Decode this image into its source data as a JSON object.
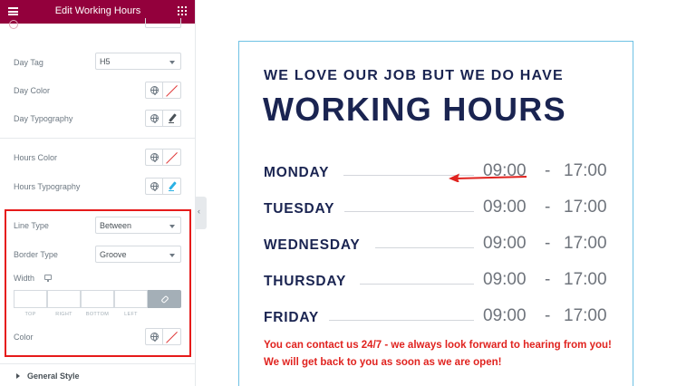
{
  "panel": {
    "title": "Edit Working Hours",
    "controls": {
      "day_tag": {
        "label": "Day Tag",
        "value": "H5"
      },
      "day_color": {
        "label": "Day Color"
      },
      "day_typography": {
        "label": "Day Typography"
      },
      "hours_color": {
        "label": "Hours Color"
      },
      "hours_typography": {
        "label": "Hours Typography"
      },
      "line_type": {
        "label": "Line Type",
        "value": "Between"
      },
      "border_type": {
        "label": "Border Type",
        "value": "Groove"
      },
      "width": {
        "label": "Width",
        "sides": [
          "TOP",
          "RIGHT",
          "BOTTOM",
          "LEFT"
        ]
      },
      "color": {
        "label": "Color"
      }
    },
    "section_general": "General Style",
    "icons": [
      "menu-icon",
      "grid-icon",
      "globe-icon",
      "reset-color-icon",
      "pencil-icon",
      "link-icon",
      "desktop-icon",
      "chevron-left-icon",
      "caret-right-icon"
    ],
    "colors": {
      "header": "#93003c",
      "highlight_box": "#e61a1a",
      "link_button": "#a4afb7"
    }
  },
  "preview": {
    "kicker": "WE LOVE OUR JOB BUT WE DO HAVE",
    "headline": "WORKING HOURS",
    "rows": [
      {
        "day": "MONDAY",
        "open": "09:00",
        "sep": "-",
        "close": "17:00"
      },
      {
        "day": "TUESDAY",
        "open": "09:00",
        "sep": "-",
        "close": "17:00"
      },
      {
        "day": "WEDNESDAY",
        "open": "09:00",
        "sep": "-",
        "close": "17:00"
      },
      {
        "day": "THURSDAY",
        "open": "09:00",
        "sep": "-",
        "close": "17:00"
      },
      {
        "day": "FRIDAY",
        "open": "09:00",
        "sep": "-",
        "close": "17:00"
      }
    ],
    "note": "You can contact us 24/7 - we always look forward to hearing from you! We will get back to you as soon as we are open!",
    "colors": {
      "heading": "#1a2451",
      "hours": "#6f747c",
      "note": "#e0231f",
      "border": "#6ec1e4",
      "arrow": "#e0231f"
    }
  }
}
